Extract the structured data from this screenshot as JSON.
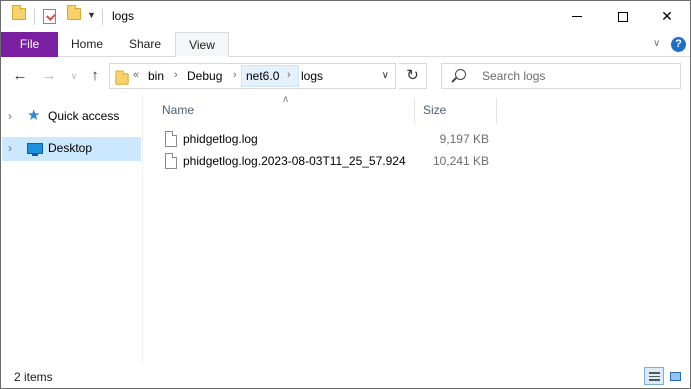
{
  "window": {
    "title": "logs"
  },
  "quick_access": {
    "items": [
      "folder-icon",
      "properties-icon",
      "new-folder-icon",
      "customize-dropdown"
    ]
  },
  "controls": {
    "minimize": "—",
    "close": "✕"
  },
  "ribbon": {
    "tabs": [
      {
        "label": "File",
        "active": false,
        "accent": "#7a1fa2"
      },
      {
        "label": "Home",
        "active": false
      },
      {
        "label": "Share",
        "active": false
      },
      {
        "label": "View",
        "active": true
      }
    ],
    "expand_icon": "chevron-down-icon",
    "help_label": "?"
  },
  "nav": {
    "back_enabled": false,
    "forward_enabled": false,
    "overflow_label": "«",
    "breadcrumbs": [
      "bin",
      "Debug",
      "net6.0",
      "logs"
    ],
    "highlighted_crumb": "net6.0",
    "refresh_icon": "refresh-icon"
  },
  "search": {
    "placeholder": "Search logs"
  },
  "sidebar": {
    "items": [
      {
        "label": "Quick access",
        "icon": "star-icon",
        "selected": false
      },
      {
        "label": "Desktop",
        "icon": "desktop-icon",
        "selected": true
      }
    ]
  },
  "list": {
    "columns": [
      {
        "label": "Name",
        "sorted": "ascending"
      },
      {
        "label": "Size"
      }
    ],
    "rows": [
      {
        "name": "phidgetlog.log",
        "size": "9,197 KB"
      },
      {
        "name": "phidgetlog.log.2023-08-03T11_25_57.924",
        "size": "10,241 KB"
      }
    ]
  },
  "status": {
    "item_count": "2 items",
    "view_modes": [
      {
        "name": "details-view",
        "active": true
      },
      {
        "name": "large-icons-view",
        "active": false
      }
    ]
  },
  "colors": {
    "selection": "#cce8ff",
    "accent": "#0078d7",
    "file_tab": "#7a1fa2"
  }
}
